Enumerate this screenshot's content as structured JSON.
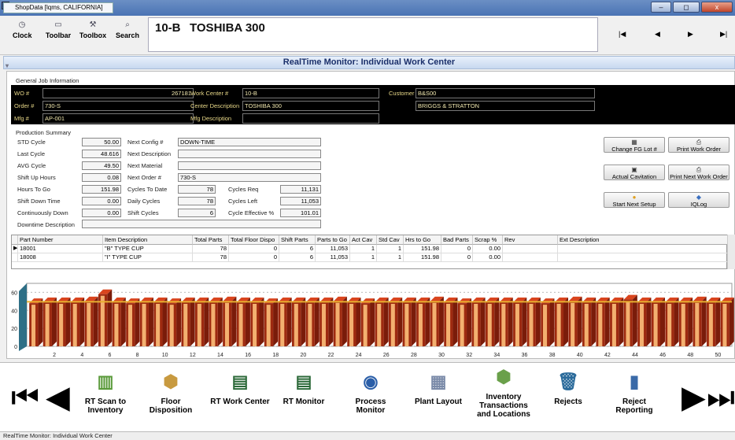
{
  "window": {
    "title": "ShopData [lqms, CALIFORNIA]",
    "min": "–",
    "max": "◻",
    "close": "x"
  },
  "toolbar": {
    "buttons": [
      {
        "label": "Clock",
        "icon": "clock-icon",
        "glyph": "◷"
      },
      {
        "label": "Toolbar",
        "icon": "toolbar-icon",
        "glyph": "▭"
      },
      {
        "label": "Toolbox",
        "icon": "toolbox-icon",
        "glyph": "⚒"
      },
      {
        "label": "Search",
        "icon": "search-icon",
        "glyph": "⌕"
      }
    ],
    "work_center_code": "10-B",
    "work_center_name": "TOSHIBA 300",
    "nav": [
      "|◀",
      "◀",
      "▶",
      "▶|"
    ]
  },
  "banner": {
    "title": "RealTime Monitor: Individual Work Center"
  },
  "general": {
    "heading": "General Job Information",
    "wo_label": "WO #",
    "wo": "267181",
    "order_label": "Order #",
    "order": "730-S",
    "mfg_label": "Mfg #",
    "mfg": "AP-001",
    "wc_label": "Work Center #",
    "wc": "10-B",
    "desc_label": "Center Description",
    "desc": "TOSHIBA 300",
    "mfgdesc_label": "Mfg Description",
    "mfgdesc": "",
    "cust_label": "Customer",
    "cust_code": "B&S00",
    "cust_name": "BRIGGS & STRATTON"
  },
  "production": {
    "heading": "Production Summary",
    "std_cycle_label": "STD Cycle",
    "std_cycle": "50.00",
    "last_cycle_label": "Last Cycle",
    "last_cycle": "48.616",
    "avg_cycle_label": "AVG Cycle",
    "avg_cycle": "49.50",
    "shift_up_label": "Shift Up Hours",
    "shift_up": "0.08",
    "hours_to_go_label": "Hours To Go",
    "hours_to_go": "151.98",
    "shift_down_label": "Shift Down Time",
    "shift_down": "0.00",
    "cont_down_label": "Continuously Down",
    "cont_down": "0.00",
    "downtime_desc_label": "Downtime Description",
    "downtime_desc": "",
    "next_config_label": "Next Config #",
    "next_config": "DOWN-TIME",
    "next_desc_label": "Next Description",
    "next_desc": "",
    "next_material_label": "Next Material",
    "next_material": "",
    "next_order_label": "Next Order #",
    "next_order": "730-S",
    "cycles_to_date_label": "Cycles To Date",
    "cycles_to_date": "78",
    "daily_cycles_label": "Daily Cycles",
    "daily_cycles": "78",
    "shift_cycles_label": "Shift Cycles",
    "shift_cycles": "6",
    "cycles_req_label": "Cycles Req",
    "cycles_req": "11,131",
    "cycles_left_label": "Cycles Left",
    "cycles_left": "11,053",
    "cycle_eff_label": "Cycle Effective %",
    "cycle_eff": "101.01"
  },
  "actions": [
    {
      "label": "Change FG Lot #",
      "glyph": "▦",
      "icon": "calendar-icon"
    },
    {
      "label": "Print Work Order",
      "glyph": "⎙",
      "icon": "printer-icon"
    },
    {
      "label": "Actual Cavitation",
      "glyph": "▣",
      "icon": "cavitation-icon"
    },
    {
      "label": "Print Next Work Order",
      "glyph": "⎙",
      "icon": "printer-icon"
    },
    {
      "label": "Start Next Setup",
      "glyph": "●",
      "icon": "setup-icon"
    },
    {
      "label": "IQLog",
      "glyph": "◆",
      "icon": "tag-icon"
    }
  ],
  "grid": {
    "headers": [
      "Part Number",
      "Item Description",
      "Total Parts",
      "Total Floor Dispo",
      "Shift Parts",
      "Parts to Go",
      "Act Cav",
      "Std Cav",
      "Hrs to Go",
      "Bad Parts",
      "Scrap %",
      "Rev",
      "Ext Description"
    ],
    "rows": [
      [
        "18001",
        "\"B\" TYPE CUP",
        "78",
        "0",
        "6",
        "11,053",
        "1",
        "1",
        "151.98",
        "0",
        "0.00",
        "",
        ""
      ],
      [
        "18008",
        "\"I\" TYPE CUP",
        "78",
        "0",
        "6",
        "11,053",
        "1",
        "1",
        "151.98",
        "0",
        "0.00",
        "",
        ""
      ]
    ]
  },
  "chart_data": {
    "type": "bar",
    "title": "",
    "xlabel": "",
    "ylabel": "",
    "ylim": [
      0,
      100
    ],
    "yticks": [
      "0",
      "20",
      "40",
      "60"
    ],
    "xticks": [
      "2",
      "4",
      "6",
      "8",
      "10",
      "12",
      "14",
      "16",
      "18",
      "20",
      "22",
      "24",
      "26",
      "28",
      "30",
      "32",
      "34",
      "36",
      "38",
      "40",
      "42",
      "44",
      "46",
      "48",
      "50"
    ],
    "reference_line": 49.5,
    "series": [
      {
        "values": [
          48,
          49,
          49,
          49,
          50,
          58,
          49,
          48,
          49,
          49,
          48,
          49,
          49,
          49,
          50,
          49,
          49,
          48,
          49,
          49,
          49,
          49,
          50,
          49,
          48,
          49,
          49,
          49,
          49,
          50,
          49,
          48,
          49,
          49,
          49,
          49,
          49,
          48,
          49,
          50,
          49,
          49,
          49,
          52,
          49,
          49,
          49,
          49,
          50,
          49,
          49
        ]
      }
    ]
  },
  "bottom": {
    "buttons": [
      {
        "label": "RT Scan to\nInventory",
        "icon": "scan-icon",
        "glyph": "▥"
      },
      {
        "label": "Floor\nDisposition",
        "icon": "box-icon",
        "glyph": "⬢"
      },
      {
        "label": "RT Work Center",
        "icon": "monitor-icon",
        "glyph": "▤"
      },
      {
        "label": "RT Monitor",
        "icon": "monitor-icon",
        "glyph": "▤"
      },
      {
        "label": "Process\nMonitor",
        "icon": "globe-monitor-icon",
        "glyph": "◉"
      },
      {
        "label": "Plant Layout",
        "icon": "layout-icon",
        "glyph": "▦"
      },
      {
        "label": "Inventory\nTransactions\nand Locations",
        "icon": "inventory-icon",
        "glyph": "⬢"
      },
      {
        "label": "Rejects",
        "icon": "trash-icon",
        "glyph": "🗑"
      },
      {
        "label": "Reject\nReporting",
        "icon": "report-icon",
        "glyph": "▮"
      }
    ],
    "first": "⏮",
    "prev": "◀",
    "next": "▶",
    "last": "⏭"
  },
  "status": {
    "text": "RealTime Monitor: Individual Work Center"
  }
}
